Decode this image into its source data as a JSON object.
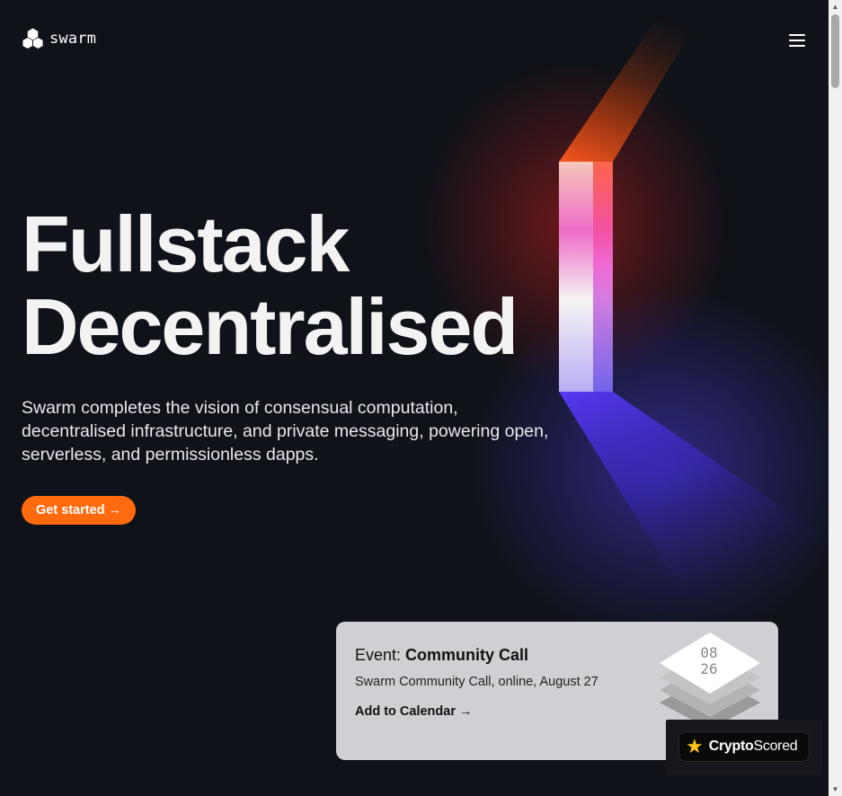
{
  "header": {
    "logo_text": "swarm",
    "logo_icon": "hexagon-cluster-icon",
    "menu_icon": "hamburger-menu-icon"
  },
  "hero": {
    "title_line1": "Fullstack",
    "title_line2": "Decentralised",
    "description": "Swarm completes the vision of consensual computation, decentralised infrastructure, and private messaging, powering open, serverless, and permissionless dapps.",
    "cta_label": "Get started →"
  },
  "event": {
    "prefix": "Event:",
    "name": "Community Call",
    "subtitle": "Swarm Community Call, online, August 27",
    "link_label": "Add to Calendar →",
    "calendar_month": "08",
    "calendar_day": "26"
  },
  "badge": {
    "icon": "star-icon",
    "text_bold": "Crypto",
    "text_regular": "Scored"
  },
  "colors": {
    "background": "#0f1218",
    "accent": "#ff6a0f",
    "card": "#cfd0d3"
  }
}
